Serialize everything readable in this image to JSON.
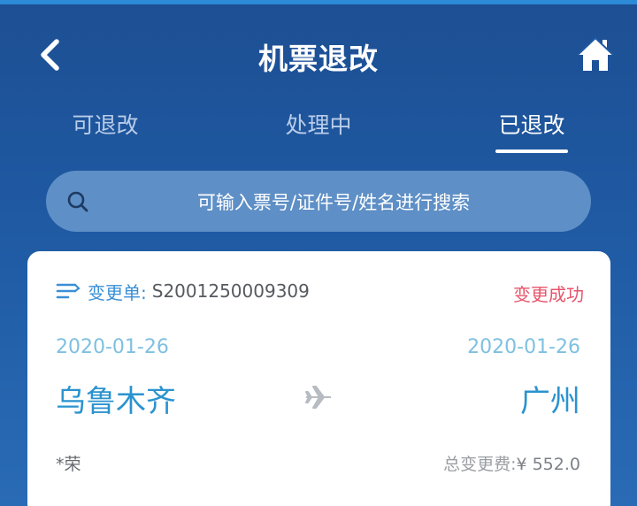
{
  "header": {
    "title": "机票退改",
    "back_icon": "chevron-left-icon",
    "home_icon": "home-icon"
  },
  "tabs": [
    {
      "label": "可退改",
      "active": false
    },
    {
      "label": "处理中",
      "active": false
    },
    {
      "label": "已退改",
      "active": true
    }
  ],
  "search": {
    "placeholder": "可输入票号/证件号/姓名进行搜索",
    "icon": "search-icon"
  },
  "card": {
    "order_label": "变更单:",
    "order_number": "S2001250009309",
    "status": "变更成功",
    "departure": {
      "date": "2020-01-26",
      "city": "乌鲁木齐"
    },
    "arrival": {
      "date": "2020-01-26",
      "city": "广州"
    },
    "passenger": "*荣",
    "fee_label": "总变更费:",
    "fee_amount": "¥ 552.0"
  },
  "colors": {
    "background": "#1f5aa3",
    "accent_blue": "#2a93cf",
    "status_red": "#e6546b",
    "search_bg": "#5e8fc6"
  }
}
